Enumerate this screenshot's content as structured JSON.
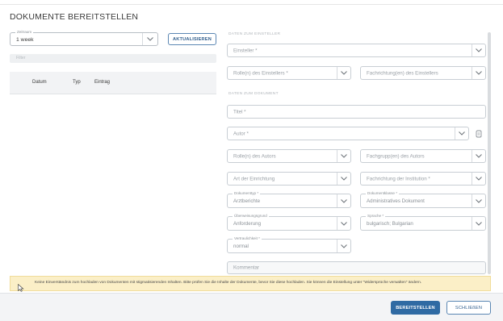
{
  "dialog": {
    "title": "DOKUMENTE BEREITSTELLEN"
  },
  "left": {
    "zeitraum": {
      "label": "Zeitraum",
      "value": "1 week"
    },
    "refresh_label": "AKTUALISIEREN",
    "filter_placeholder": "Filter",
    "table": {
      "columns": [
        "Datum",
        "Typ",
        "Eintrag"
      ]
    }
  },
  "right": {
    "section_einsteller": "DATEN ZUM EINSTELLER",
    "einsteller": "Einsteller *",
    "rolle_einsteller": "Rolle(n) des Einstellers *",
    "fachrichtung_einsteller": "Fachrichtung(en) des Einstellers",
    "section_dokument": "DATEN ZUM DOKUMENT",
    "titel": "Titel *",
    "autor": "Autor *",
    "rolle_autor": "Rolle(n) des Autors",
    "fachgruppe_autor": "Fachgrupp(en) des Autors",
    "art_einrichtung": "Art der Einrichtung",
    "fachrichtung_institution": "Fachrichtung der Institution *",
    "dokumenttyp": {
      "label": "Dokumenttyp *",
      "value": "Arztberichte"
    },
    "dokumentklasse": {
      "label": "Dokumentklasse *",
      "value": "Administratives Dokument"
    },
    "uberweisung": {
      "label": "Überweisungsgrund",
      "value": "Anforderung"
    },
    "sprache": {
      "label": "Sprache *",
      "value": "bulgarisch; Bulgarian"
    },
    "vertraulichkeit": {
      "label": "Vertraulichkeit *",
      "value": "normal"
    },
    "kommentar": "Kommentar"
  },
  "notice": "Keine Einverständnis zum hochladen von Dokumenten mit stigmatisierenden Inhalten. Bitte prüfen Sie die Inhalte der Dokumente, bevor Sie diese hochladen. Sie können die Einstellung unter \"Widersprüche verwalten\" ändern.",
  "footer": {
    "submit_label": "BEREITSTELLEN",
    "close_label": "SCHLIEßEN"
  },
  "colors": {
    "accent": "#2f6aa3",
    "notice_bg": "#fbefc7",
    "border": "#c8ced4"
  },
  "icons": {
    "chevron": "chevron-down-icon",
    "attach": "paperclip-icon",
    "cursor": "mouse-cursor-icon"
  }
}
